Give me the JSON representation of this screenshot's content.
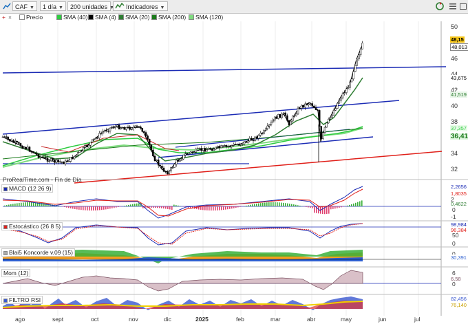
{
  "toolbar": {
    "symbol": "CAF",
    "period": "1 día",
    "units": "200 unidades",
    "indicators": "Indicadores"
  },
  "legend": [
    {
      "label": "Precio",
      "color": "#ffffff"
    },
    {
      "label": "SMA (40)",
      "color": "#2ecc40"
    },
    {
      "label": "SMA (4)",
      "color": "#000000"
    },
    {
      "label": "SMA (20)",
      "color": "#2e7d32"
    },
    {
      "label": "SMA (200)",
      "color": "#1a7a1a"
    },
    {
      "label": "SMA (120)",
      "color": "#7fdc7f"
    }
  ],
  "price_axis": [
    "50",
    "48",
    "46",
    "44",
    "42",
    "40",
    "38",
    "36",
    "34",
    "32"
  ],
  "price_tags": {
    "last": "48,15",
    "close": "48,013",
    "sma4": "43,675",
    "sma20": "41,519",
    "sma40": "37,357",
    "sma120": "36,41"
  },
  "watermark": "ProRealTime.com - Fin de Día",
  "panes": {
    "macd": {
      "title": "MACD (12 26 9)",
      "axis": [
        "2",
        "1",
        "0",
        "-1"
      ],
      "tags": [
        "2,2656",
        "1,8035",
        "0,4622"
      ]
    },
    "stoch": {
      "title": "Estocástico (26 8 5)",
      "axis": [
        "100",
        "50",
        "0"
      ],
      "tags": [
        "98,984",
        "96,384"
      ]
    },
    "blai5": {
      "title": "Blai5 Koncorde v.09 (15)",
      "axis": [
        "0"
      ],
      "tags": [
        "30,391"
      ]
    },
    "mom": {
      "title": "Mom (12)",
      "axis": [
        "6",
        "3",
        "0"
      ],
      "tags": [
        "6,58"
      ]
    },
    "rsi": {
      "title": "FILTRO RSI",
      "axis": [],
      "tags": [
        "82,456",
        "76,140"
      ]
    }
  },
  "months": [
    "ago",
    "sept",
    "oct",
    "nov",
    "dic",
    "2025",
    "feb",
    "mar",
    "abr",
    "may",
    "jun",
    "jul"
  ],
  "colors": {
    "up": "#ffffff",
    "down": "#000000",
    "channel": "#1c2cb5",
    "support": "#e0201a",
    "sma40": "#2ecc40",
    "sma120": "#7fdc7f"
  }
}
